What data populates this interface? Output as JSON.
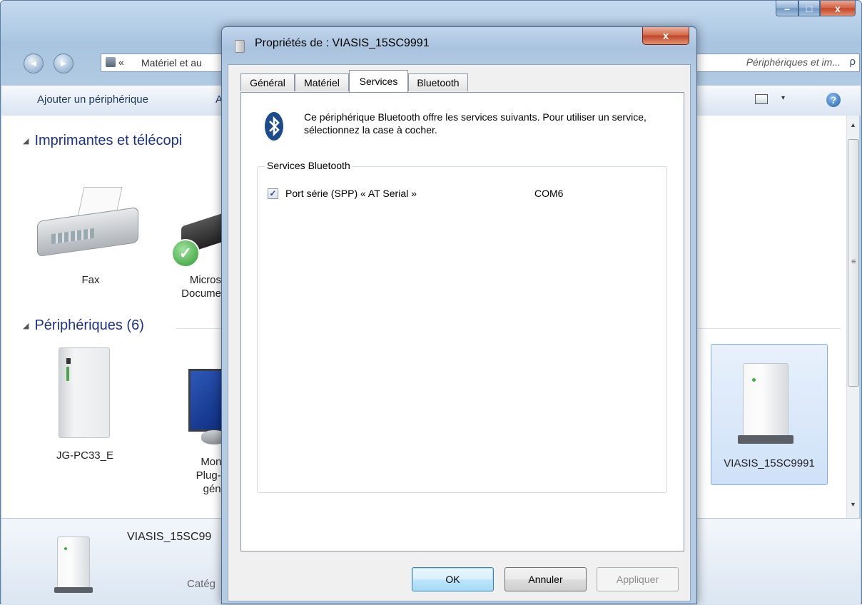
{
  "explorer": {
    "window_controls": {
      "minimize": "–",
      "maximize": "□",
      "close": "x"
    },
    "nav": {
      "back_symbol": "◀",
      "forward_symbol": "▶",
      "breadcrumb_prefix": "«",
      "breadcrumb": "Matériel et au",
      "search_placeholder": "Périphériques et im...",
      "search_icon": "ρ"
    },
    "command_bar": {
      "add_device": "Ajouter un périphérique",
      "second_item": "A",
      "view_arrow": "▾",
      "help": "?"
    },
    "groups": {
      "printers": {
        "arrow": "◢",
        "title": "Imprimantes et télécopi"
      },
      "devices": {
        "arrow": "◢",
        "title": "Périphériques (6)"
      }
    },
    "printers": [
      {
        "label": "Fax"
      },
      {
        "label": "Micros\nDocume"
      }
    ],
    "devices": [
      {
        "label": "JG-PC33_E"
      },
      {
        "label": "Monit\nPlug-a\ngéné"
      },
      {
        "label": "VIASIS_15SC9991"
      }
    ],
    "details": {
      "name": "VIASIS_15SC99",
      "category": "Catég"
    },
    "scrollbar": {
      "up": "▲",
      "down": "▼",
      "grip": "≡"
    }
  },
  "dialog": {
    "title": "Propriétés de : VIASIS_15SC9991",
    "close": "x",
    "tabs": [
      {
        "label": "Général",
        "active": false
      },
      {
        "label": "Matériel",
        "active": false
      },
      {
        "label": "Services",
        "active": true
      },
      {
        "label": "Bluetooth",
        "active": false
      }
    ],
    "intro": "Ce périphérique Bluetooth offre les services suivants. Pour utiliser un service, sélectionnez la case à cocher.",
    "services_group_title": "Services Bluetooth",
    "services": [
      {
        "name": "Port série (SPP) « AT Serial »",
        "port": "COM6",
        "checked": true,
        "check_symbol": "✓"
      }
    ],
    "buttons": {
      "ok": "OK",
      "cancel": "Annuler",
      "apply": "Appliquer"
    }
  },
  "colors": {
    "accent": "#1e3287",
    "title_bar": "#a9c2de",
    "bluetooth": "#1b4b8c"
  }
}
